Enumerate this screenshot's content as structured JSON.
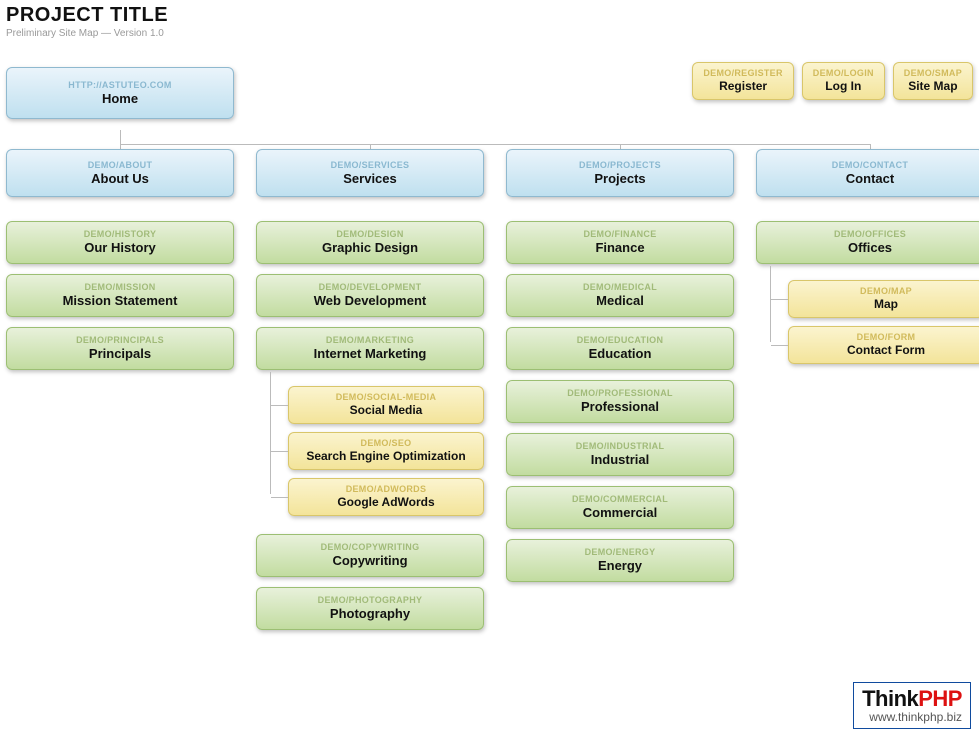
{
  "header": {
    "title": "PROJECT TITLE",
    "subtitle": "Preliminary Site Map — Version 1.0"
  },
  "utility": [
    {
      "path": "DEMO/REGISTER",
      "label": "Register"
    },
    {
      "path": "DEMO/LOGIN",
      "label": "Log In"
    },
    {
      "path": "DEMO/SMAP",
      "label": "Site Map"
    }
  ],
  "home": {
    "path": "HTTP://ASTUTEO.COM",
    "label": "Home"
  },
  "sections": {
    "about": {
      "head": {
        "path": "DEMO/ABOUT",
        "label": "About Us"
      },
      "children": [
        {
          "path": "DEMO/HISTORY",
          "label": "Our History"
        },
        {
          "path": "DEMO/MISSION",
          "label": "Mission Statement"
        },
        {
          "path": "DEMO/PRINCIPALS",
          "label": "Principals"
        }
      ]
    },
    "services": {
      "head": {
        "path": "DEMO/SERVICES",
        "label": "Services"
      },
      "children": [
        {
          "path": "DEMO/DESIGN",
          "label": "Graphic Design"
        },
        {
          "path": "DEMO/DEVELOPMENT",
          "label": "Web Development"
        },
        {
          "path": "DEMO/MARKETING",
          "label": "Internet Marketing"
        }
      ],
      "marketing_sub": [
        {
          "path": "DEMO/SOCIAL-MEDIA",
          "label": "Social Media"
        },
        {
          "path": "DEMO/SEO",
          "label": "Search Engine Optimization"
        },
        {
          "path": "DEMO/ADWORDS",
          "label": "Google AdWords"
        }
      ],
      "tail": [
        {
          "path": "DEMO/COPYWRITING",
          "label": "Copywriting"
        },
        {
          "path": "DEMO/PHOTOGRAPHY",
          "label": "Photography"
        }
      ]
    },
    "projects": {
      "head": {
        "path": "DEMO/PROJECTS",
        "label": "Projects"
      },
      "children": [
        {
          "path": "DEMO/FINANCE",
          "label": "Finance"
        },
        {
          "path": "DEMO/MEDICAL",
          "label": "Medical"
        },
        {
          "path": "DEMO/EDUCATION",
          "label": "Education"
        },
        {
          "path": "DEMO/PROFESSIONAL",
          "label": "Professional"
        },
        {
          "path": "DEMO/INDUSTRIAL",
          "label": "Industrial"
        },
        {
          "path": "DEMO/COMMERCIAL",
          "label": "Commercial"
        },
        {
          "path": "DEMO/ENERGY",
          "label": "Energy"
        }
      ]
    },
    "contact": {
      "head": {
        "path": "DEMO/CONTACT",
        "label": "Contact"
      },
      "children": [
        {
          "path": "DEMO/OFFICES",
          "label": "Offices"
        }
      ],
      "offices_sub": [
        {
          "path": "DEMO/MAP",
          "label": "Map"
        },
        {
          "path": "DEMO/FORM",
          "label": "Contact Form"
        }
      ]
    }
  },
  "logo": {
    "part1": "Think",
    "part2": "PHP",
    "url": "www.thinkphp.biz"
  }
}
